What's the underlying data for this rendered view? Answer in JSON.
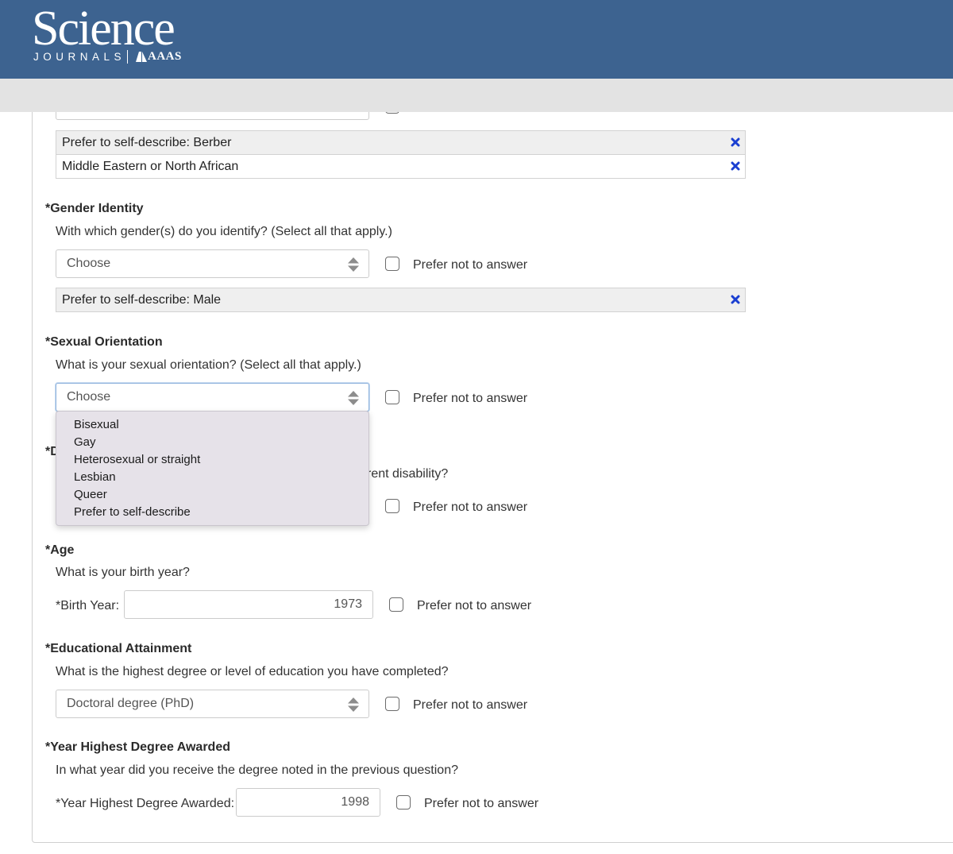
{
  "header": {
    "logo_main": "Science",
    "logo_journals": "JOURNALS",
    "logo_aaas": "AAAS"
  },
  "ethnicity": {
    "tags": [
      "Prefer to self-describe: Berber",
      "Middle Eastern or North African"
    ]
  },
  "gender": {
    "title": "*Gender Identity",
    "question": "With which gender(s) do you identify? (Select all that apply.)",
    "select_value": "Choose",
    "prefer_not": "Prefer not to answer",
    "tags": [
      "Prefer to self-describe: Male"
    ]
  },
  "orientation": {
    "title": "*Sexual Orientation",
    "question": "What is your sexual orientation? (Select all that apply.)",
    "select_value": "Choose",
    "prefer_not": "Prefer not to answer",
    "options": [
      "Bisexual",
      "Gay",
      "Heterosexual or straight",
      "Lesbian",
      "Queer",
      "Prefer to self-describe"
    ]
  },
  "disability": {
    "title_partial": "*D",
    "question_partial": "rent disability?",
    "prefer_not": "Prefer not to answer"
  },
  "age": {
    "title": "*Age",
    "question": "What is your birth year?",
    "field_label": "*Birth Year:",
    "value": "1973",
    "prefer_not": "Prefer not to answer"
  },
  "education": {
    "title": "*Educational Attainment",
    "question": "What is the highest degree or level of education you have completed?",
    "select_value": "Doctoral degree (PhD)",
    "prefer_not": "Prefer not to answer"
  },
  "degree_year": {
    "title": "*Year Highest Degree Awarded",
    "question": "In what year did you receive the degree noted in the previous question?",
    "field_label": "*Year Highest Degree Awarded:",
    "value": "1998",
    "prefer_not": "Prefer not to answer"
  },
  "colors": {
    "header": "#3d6390",
    "remove_icon": "#1a3fd1"
  },
  "icons": {
    "remove": "close-x-icon",
    "select_arrows": "up-down-arrows-icon"
  }
}
